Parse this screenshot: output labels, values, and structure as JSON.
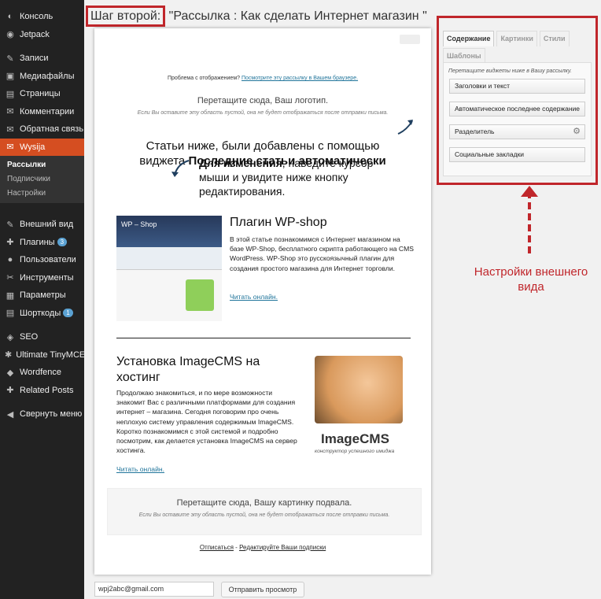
{
  "sidebar": {
    "items": [
      {
        "label": "Консоль",
        "icon": "dashboard-icon",
        "glyph": "◐"
      },
      {
        "label": "Jetpack",
        "icon": "jetpack-icon",
        "glyph": "◉"
      },
      {
        "label": "Записи",
        "icon": "pin-icon",
        "glyph": "✎"
      },
      {
        "label": "Медиафайлы",
        "icon": "media-icon",
        "glyph": "▣"
      },
      {
        "label": "Страницы",
        "icon": "pages-icon",
        "glyph": "▤"
      },
      {
        "label": "Комментарии",
        "icon": "comments-icon",
        "glyph": "✉"
      },
      {
        "label": "Обратная связь",
        "icon": "feedback-icon",
        "glyph": "✉"
      },
      {
        "label": "Wysija",
        "icon": "wysija-icon",
        "glyph": "✉"
      },
      {
        "label": "Внешний вид",
        "icon": "appearance-icon",
        "glyph": "✎"
      },
      {
        "label": "Плагины",
        "icon": "plugins-icon",
        "glyph": "✚",
        "badge": "3"
      },
      {
        "label": "Пользователи",
        "icon": "users-icon",
        "glyph": "●"
      },
      {
        "label": "Инструменты",
        "icon": "tools-icon",
        "glyph": "✂"
      },
      {
        "label": "Параметры",
        "icon": "settings-icon",
        "glyph": "▦"
      },
      {
        "label": "Шорткоды",
        "icon": "shortcodes-icon",
        "glyph": "▤",
        "badge": "1"
      },
      {
        "label": "SEO",
        "icon": "seo-icon",
        "glyph": "◈"
      },
      {
        "label": "Ultimate TinyMCE",
        "icon": "tinymce-icon",
        "glyph": "✱"
      },
      {
        "label": "Wordfence",
        "icon": "wordfence-icon",
        "glyph": "◆"
      },
      {
        "label": "Related Posts",
        "icon": "related-posts-icon",
        "glyph": "✚"
      },
      {
        "label": "Свернуть меню",
        "icon": "collapse-icon",
        "glyph": "◀"
      }
    ],
    "submenu": [
      "Рассылки",
      "Подписчики",
      "Настройки"
    ]
  },
  "title": {
    "step": "Шаг второй:",
    "rest": " \"Рассылка : Как сделать Интернет магазин \""
  },
  "email": {
    "problem_prefix": "Проблема с отображением?",
    "problem_link": "Посмотрите эту рассылку в Вашем браузере.",
    "logo_zone": "Перетащите сюда, Ваш логотип.",
    "empty_note": "Если Вы оставите эту область пустой, она не будет отображаться после отправки письма.",
    "promo1_a": "Статьи ниже, были добавлены с помощью",
    "promo1_b": "виджета ",
    "promo1_bold": "Последние статьи автоматически",
    "promo2_bold": "Для изменения",
    "promo2_rest": ", наведите курсор мыши и увидите ниже кнопку редактирования.",
    "article1": {
      "title": "Плагин WP-shop",
      "text": "В этой статье познакомимся с Интернет магазином на базе WP-Shop, бесплатного скрипта работающего на CMS WordPress. WP-Shop это русскоязычный плагин для создания простого магазина для Интернет торговли.",
      "link": "Читать онлайн."
    },
    "article2": {
      "title": "Установка ImageCMS на хостинг",
      "text": "Продолжаю знакомиться, и по мере возможности знакомит Вас с различными платформами для создания интернет – магазина. Сегодня поговорим про очень неплохую систему управления содержимым ImageCMS. Коротко познакомимся с этой системой и подробно посмотрим, как делается установка ImageCMS на сервер хостинга.",
      "link": "Читать онлайн."
    },
    "footer_zone": "Перетащите сюда, Вашу картинку подвала.",
    "unsub_a": "Отписаться",
    "unsub_sep": " - ",
    "unsub_b": "Редактируйте Ваши подписки",
    "wpshop_logo": "WP – Shop",
    "imagecms_logo": "ImageCMS",
    "imagecms_sub": "конструктор успешного имиджа"
  },
  "panel": {
    "tabs": [
      "Содержание",
      "Картинки",
      "Стили"
    ],
    "tab2": "Шаблоны",
    "note": "Перетащите виджеты ниже в Вашу рассылку.",
    "widgets": [
      "Заголовки и текст",
      "Автоматическое последнее содержание",
      "Разделитель",
      "Социальные закладки"
    ]
  },
  "annotation": "Настройки внешнего вида",
  "preview": {
    "email": "wpj2abc@gmail.com",
    "button": "Отправить просмотр"
  },
  "colors": {
    "accent": "#c0262b",
    "active_menu": "#d54e21",
    "link": "#21759b"
  }
}
